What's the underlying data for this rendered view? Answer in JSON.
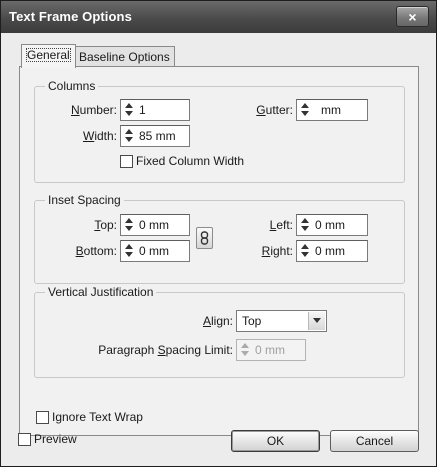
{
  "window": {
    "title": "Text Frame Options",
    "close_glyph": "×"
  },
  "tabs": [
    {
      "label": "General",
      "active": true
    },
    {
      "label": "Baseline Options",
      "active": false
    }
  ],
  "columns": {
    "legend": "Columns",
    "number": {
      "label_pre": "",
      "label_ul": "N",
      "label_post": "umber:",
      "value": "1"
    },
    "width": {
      "label_pre": "",
      "label_ul": "W",
      "label_post": "idth:",
      "value": "85 mm"
    },
    "gutter": {
      "label_pre": "",
      "label_ul": "G",
      "label_post": "utter:",
      "value": "mm"
    },
    "fixed_width": {
      "label": "Fixed Column Width",
      "checked": false
    }
  },
  "inset": {
    "legend": "Inset Spacing",
    "top": {
      "label_pre": "",
      "label_ul": "T",
      "label_post": "op:",
      "value": "0 mm"
    },
    "bottom": {
      "label_pre": "",
      "label_ul": "B",
      "label_post": "ottom:",
      "value": "0 mm"
    },
    "left": {
      "label_pre": "",
      "label_ul": "L",
      "label_post": "eft:",
      "value": "0 mm"
    },
    "right": {
      "label_pre": "",
      "label_ul": "R",
      "label_post": "ight:",
      "value": "0 mm"
    }
  },
  "vertical": {
    "legend": "Vertical Justification",
    "align": {
      "label_pre": "",
      "label_ul": "A",
      "label_post": "lign:",
      "value": "Top"
    },
    "para_limit": {
      "label_pre": "Paragraph ",
      "label_ul": "S",
      "label_post": "pacing Limit:",
      "value": "0 mm",
      "disabled": true
    }
  },
  "ignore_wrap": {
    "label": "Ignore Text Wrap",
    "checked": false
  },
  "footer": {
    "preview": {
      "label": "Preview",
      "checked": false
    },
    "ok_label": "OK",
    "cancel_label": "Cancel"
  },
  "icons": {
    "link": "chain-link-icon",
    "spinner": "spinner-arrows-icon",
    "dropdown": "chevron-down-icon"
  }
}
